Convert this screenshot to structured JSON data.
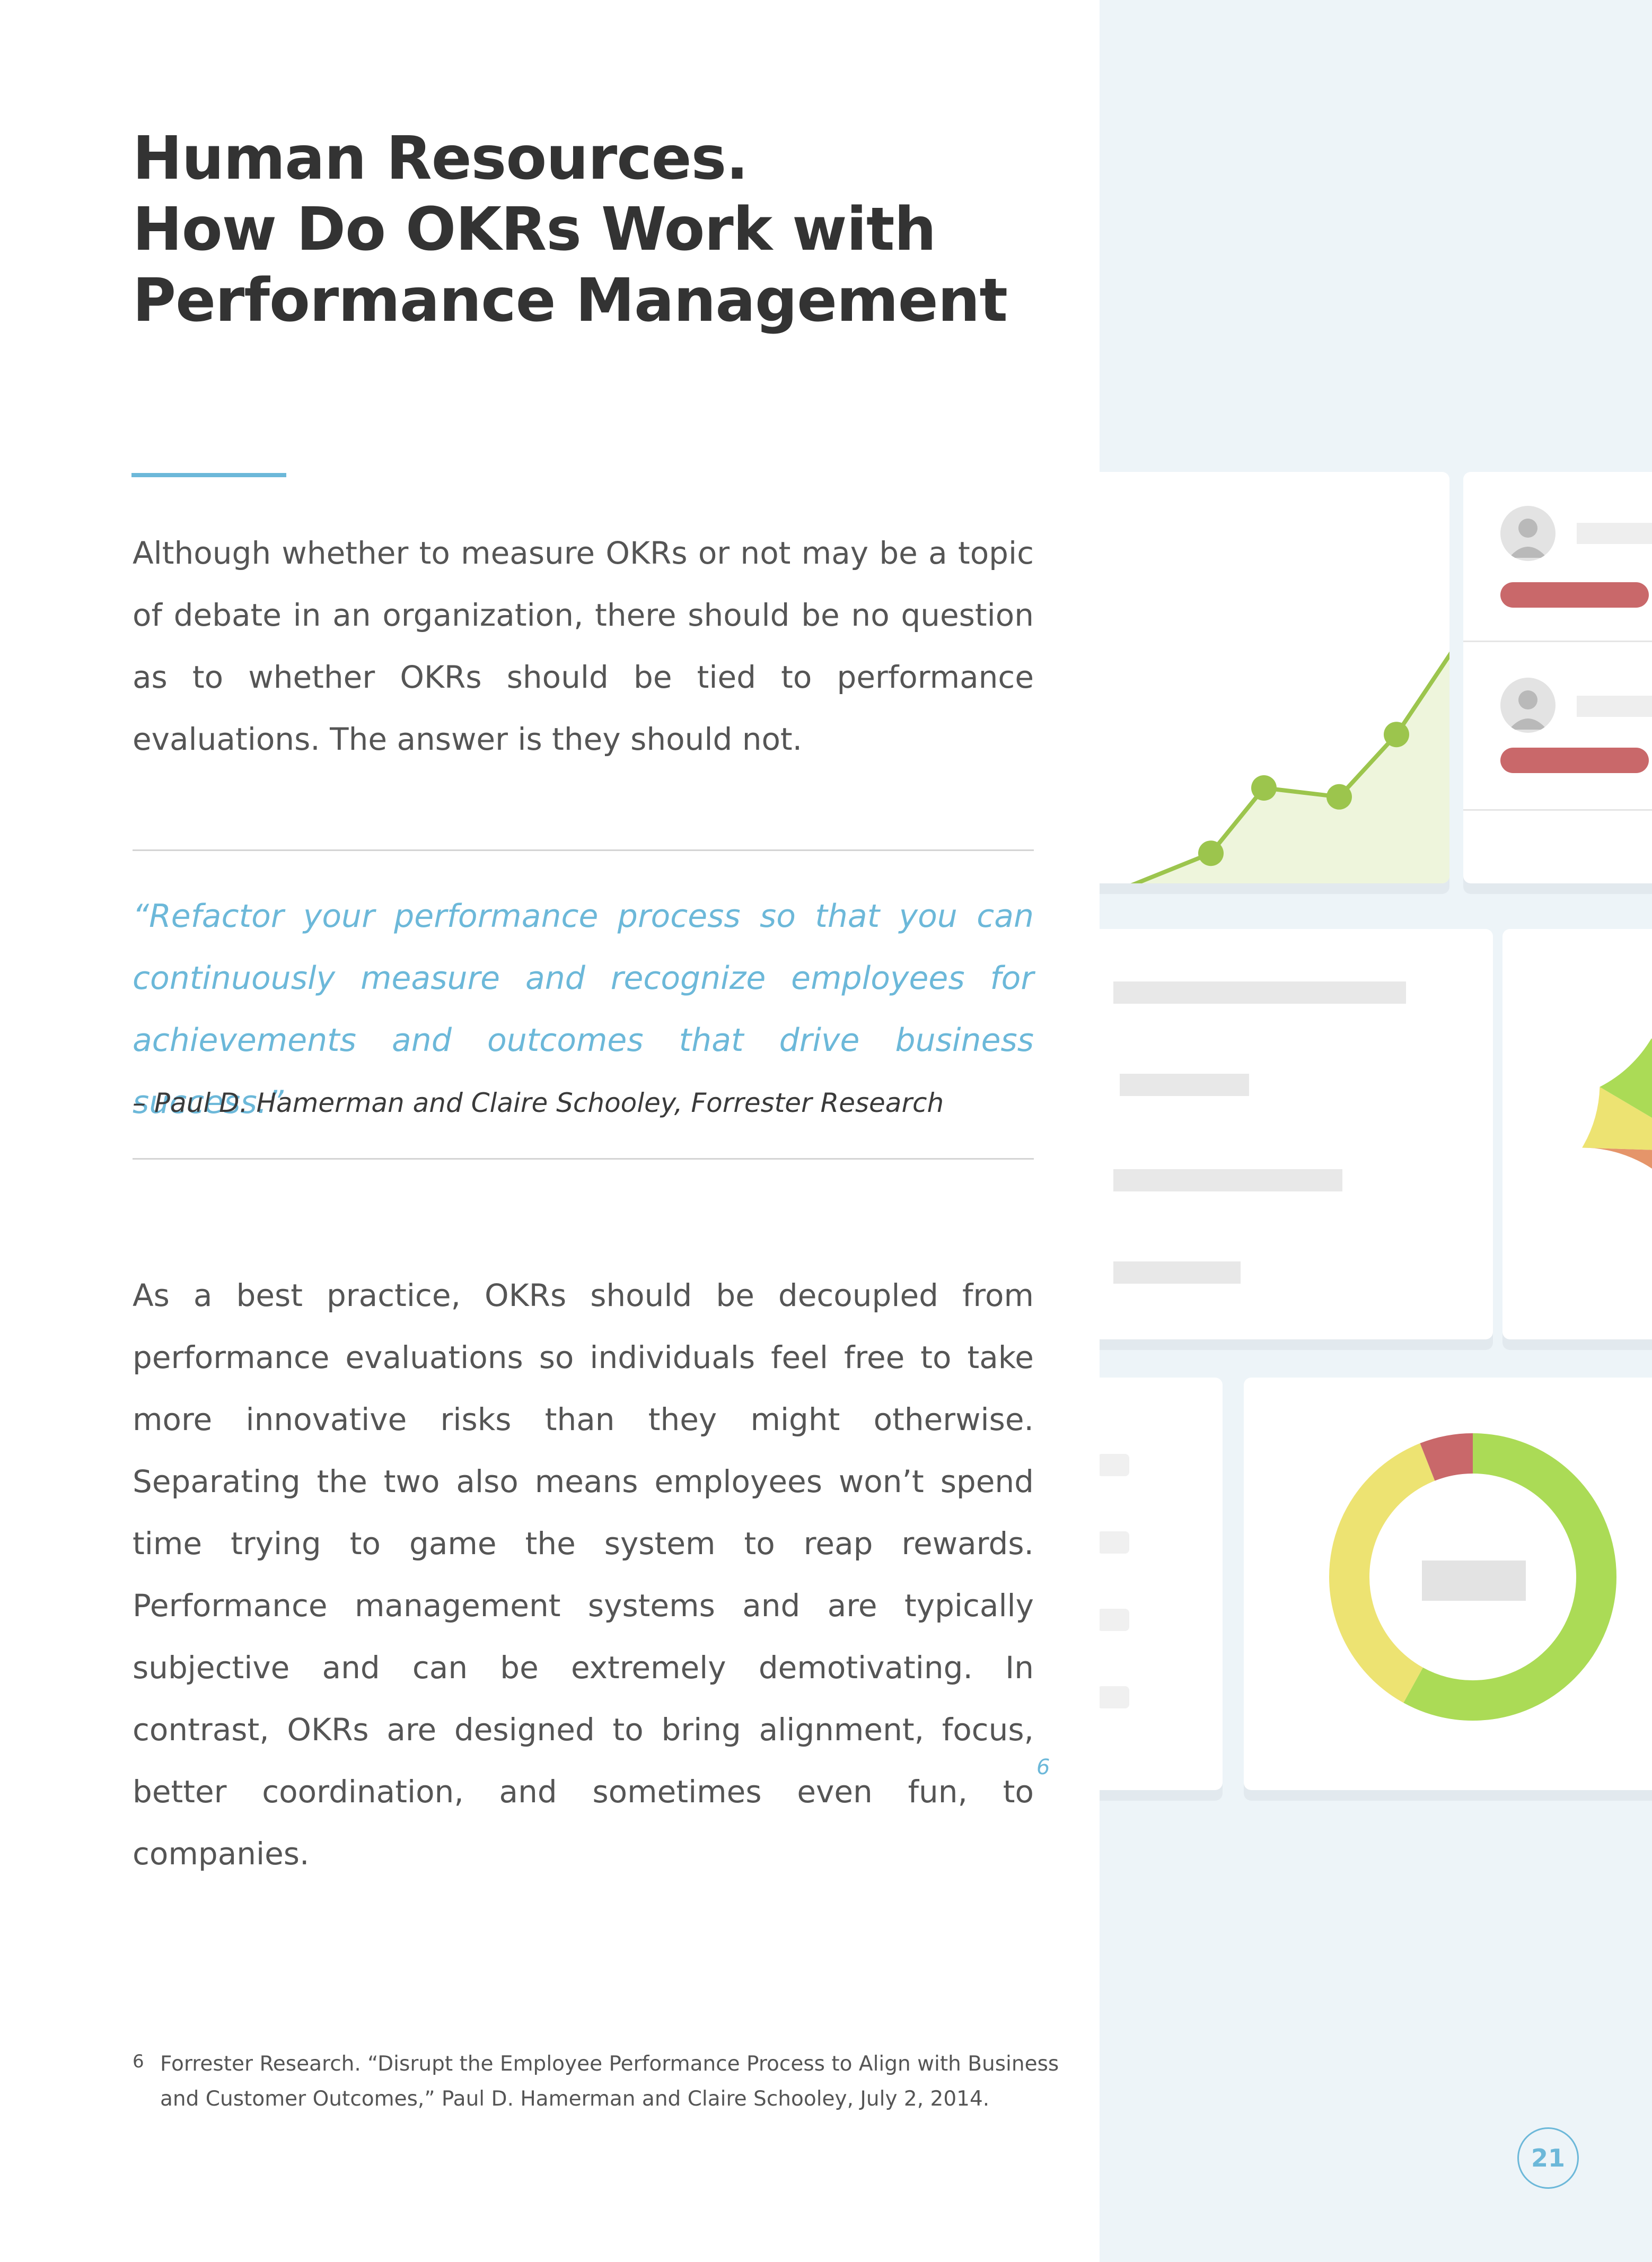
{
  "heading": {
    "line1": "Human Resources.",
    "line2": "How Do OKRs Work with",
    "line3": "Performance Management"
  },
  "intro_paragraph": "Although whether to measure OKRs or not may be a topic of debate in an organization, there should be no question as to whether OKRs should be tied to performance evaluations. The answer is they should not.",
  "quote": {
    "text": "“Refactor your performance process so that you can continuously measure and recognize employees for achievements and outcomes that drive business success.”",
    "attribution": "– Paul D. Hamerman and Claire Schooley, Forrester Research"
  },
  "body_paragraph": "As a best practice, OKRs should be decoupled from performance evaluations so individuals feel free to take more innovative risks than they might otherwise. Separating the two also means employees won’t spend time trying to game the system to reap rewards. Performance management systems and are typically subjective and can be extremely demotivating. In contrast, OKRs are designed to bring alignment, focus, better coordination, and sometimes even fun, to companies.",
  "footnote": {
    "ref": "6",
    "number": "6",
    "text": "Forrester Research. “Disrupt the Employee Performance Process to Align with Business and Customer Outcomes,” Paul D. Hamerman and Claire Schooley, July 2, 2014."
  },
  "page_number": "21",
  "colors": {
    "accent_blue": "#6cb8d9",
    "line_green": "#9cc54d",
    "area_green": "#eef5dc",
    "status_red": "#c9686a",
    "pie_orange": "#e5956a",
    "pie_yellow": "#ede372",
    "donut_green": "#abdb56",
    "donut_yellow": "#ede372",
    "donut_red": "#c9686a",
    "panel_bg": "#edf4f8"
  },
  "illustration": {
    "line_chart_values": [
      0,
      18,
      40,
      37,
      58,
      90
    ],
    "donut_segments": [
      {
        "name": "green",
        "fraction": 0.58
      },
      {
        "name": "yellow",
        "fraction": 0.36
      },
      {
        "name": "red",
        "fraction": 0.06
      }
    ],
    "pie_segments": [
      {
        "name": "orange",
        "fraction": 0.5
      },
      {
        "name": "yellow",
        "fraction": 0.3
      },
      {
        "name": "green",
        "fraction": 0.2
      }
    ]
  }
}
